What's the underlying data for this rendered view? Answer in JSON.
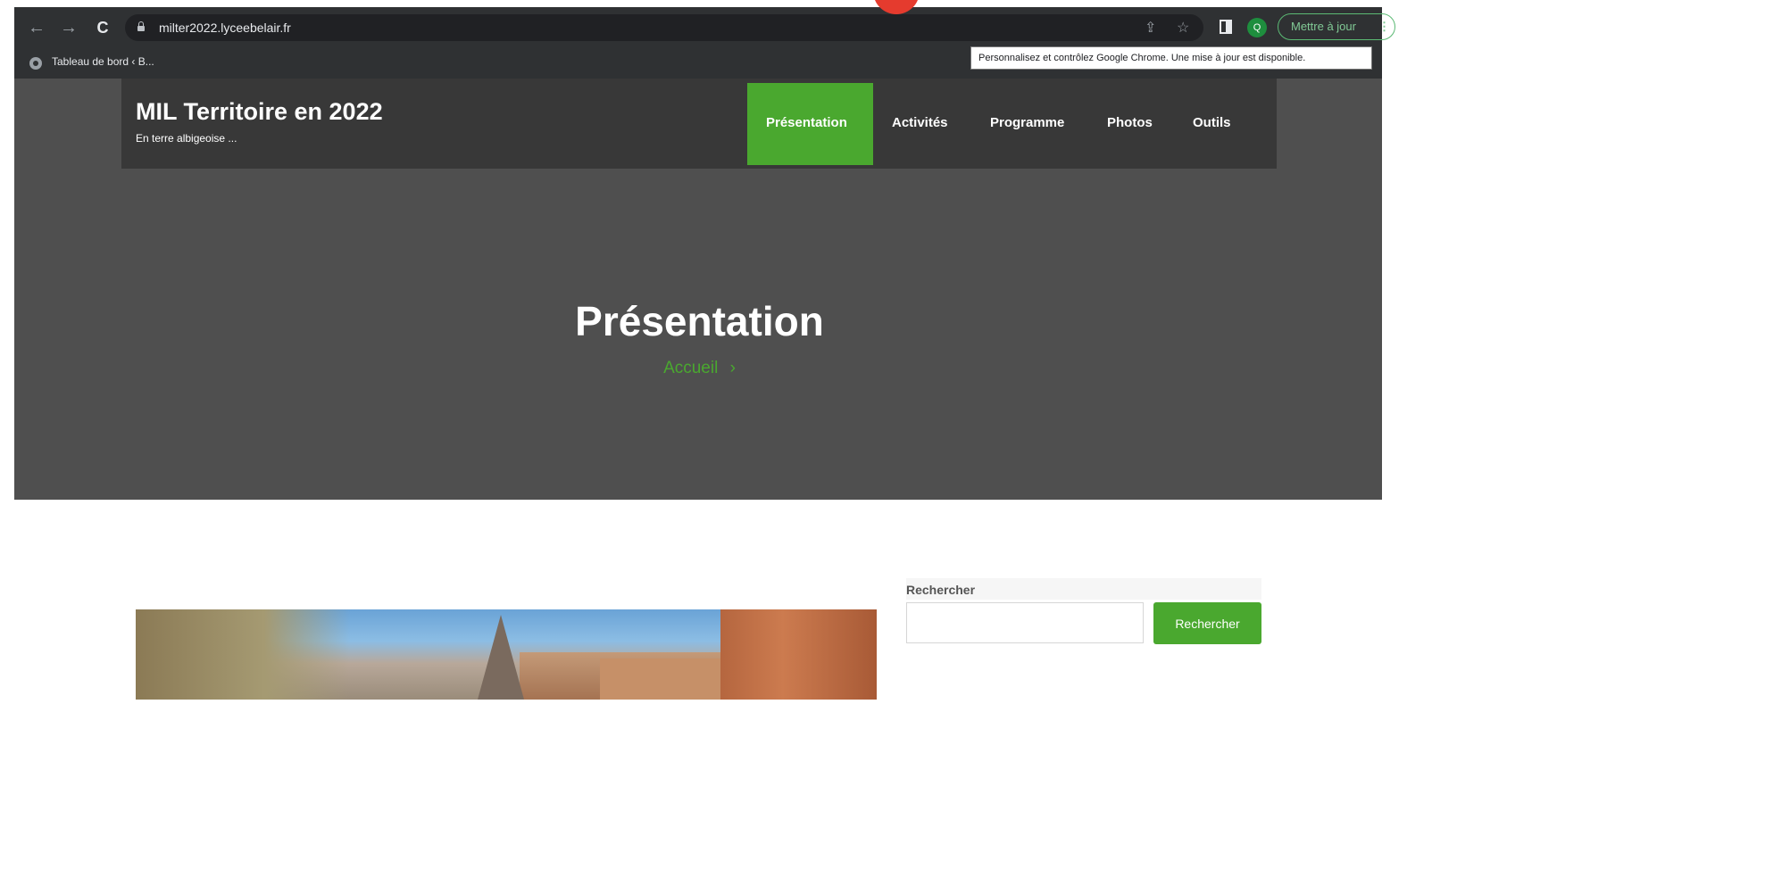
{
  "browser": {
    "back_icon": "←",
    "forward_icon": "→",
    "reload_icon": "C",
    "url": "milter2022.lyceebelair.fr",
    "share_icon": "⇪",
    "star_icon": "☆",
    "profile_initial": "Q",
    "update_label": "Mettre à jour",
    "menu_icon": "⋮",
    "bookmark_label": "Tableau de bord ‹ B...",
    "tooltip": "Personnalisez et contrôlez Google Chrome. Une mise à jour est disponible."
  },
  "site": {
    "title": "MIL Territoire en 2022",
    "tagline": "En terre albigeoise ...",
    "menu": [
      {
        "label": "Présentation",
        "active": true
      },
      {
        "label": "Activités",
        "active": false
      },
      {
        "label": "Programme",
        "active": false
      },
      {
        "label": "Photos",
        "active": false
      },
      {
        "label": "Outils",
        "active": false
      }
    ]
  },
  "hero": {
    "title": "Présentation",
    "breadcrumb": "Accueil",
    "breadcrumb_sep": "›"
  },
  "sidebar": {
    "search_label": "Rechercher",
    "search_value": "",
    "search_button": "Rechercher"
  },
  "colors": {
    "accent": "#4aa82f",
    "hero_bg": "#4f4f4f",
    "header_bg": "#383838",
    "chrome_bg": "#2f3133"
  }
}
